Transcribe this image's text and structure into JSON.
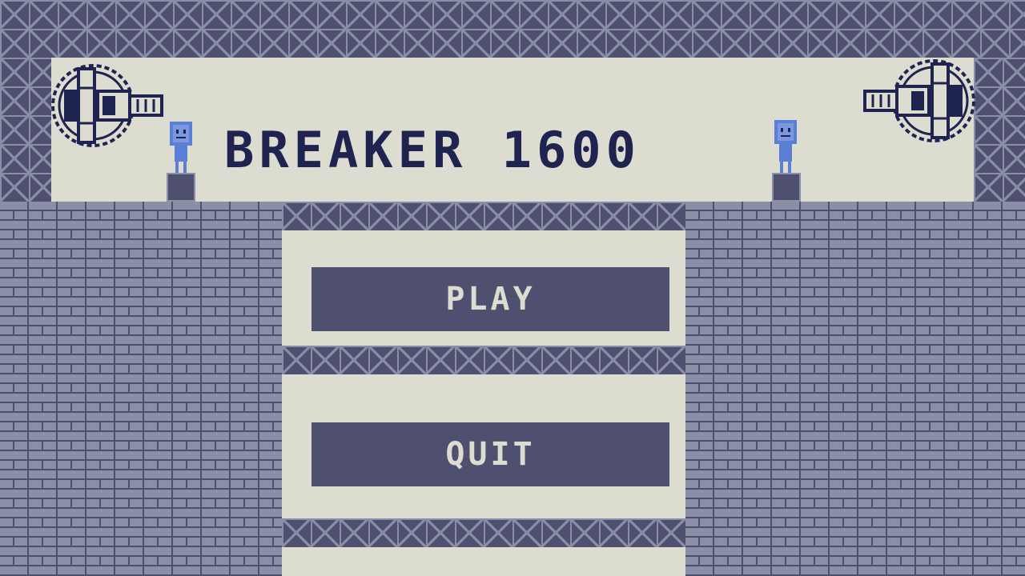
{
  "game": {
    "title": "BREAKER 1600"
  },
  "menu": {
    "play_label": "PLAY",
    "quit_label": "QUIT"
  },
  "palette": {
    "dark": "#4f5070",
    "mid": "#8b8fa6",
    "light": "#dcdcd0",
    "navy": "#1f2350",
    "figure_blue": "#5c7fd6"
  },
  "icons": {
    "left_cannon": "cannon-icon",
    "right_cannon": "cannon-icon",
    "left_figure": "robot-figure-icon",
    "right_figure": "robot-figure-icon"
  }
}
